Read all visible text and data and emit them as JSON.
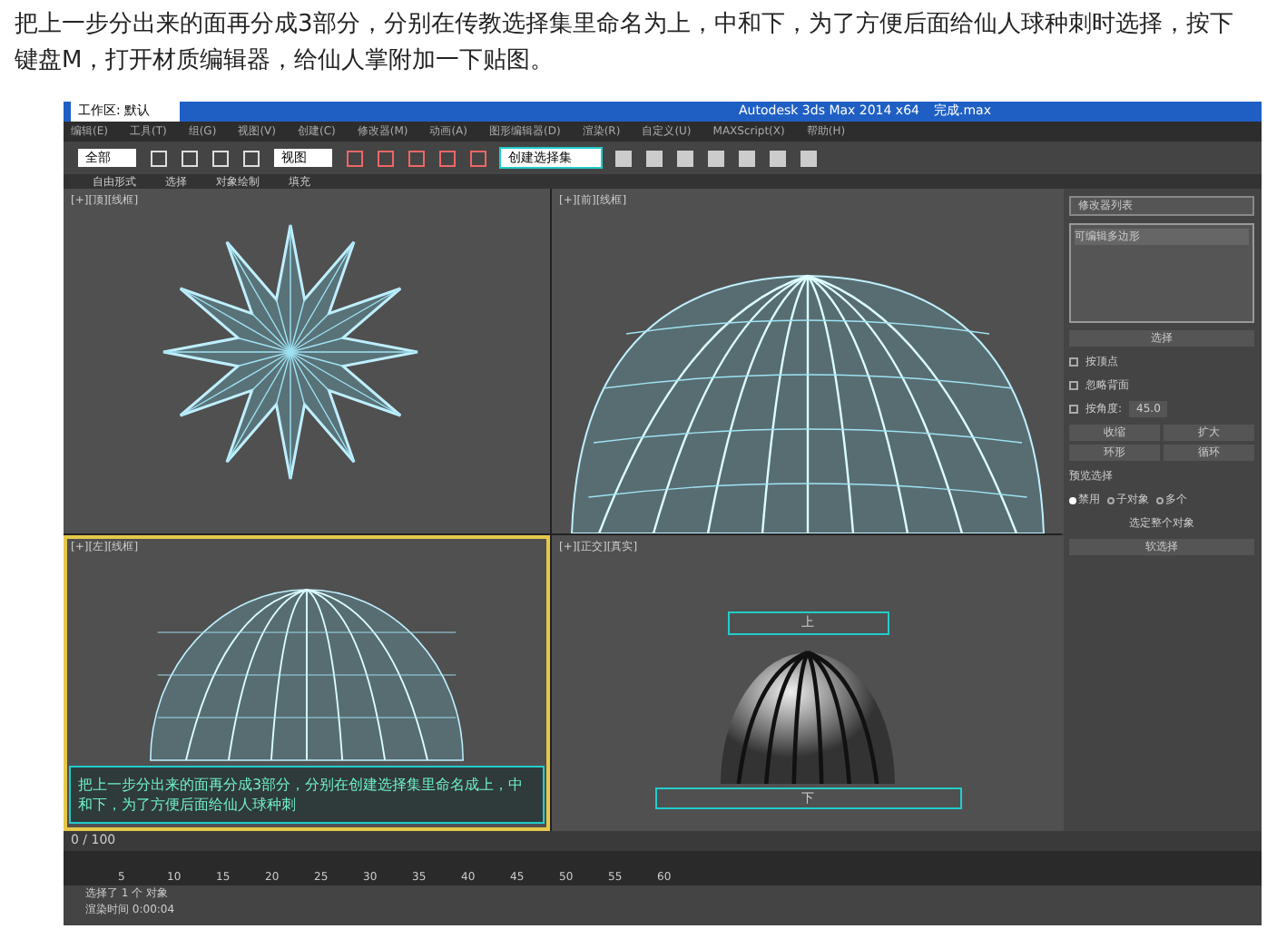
{
  "intro": {
    "text": "把上一步分出来的面再分成3部分，分别在传教选择集里命名为上，中和下，为了方便后面给仙人球种刺时选择，按下键盘M，打开材质编辑器，给仙人掌附加一下贴图。"
  },
  "app": {
    "workspace": "工作区: 默认",
    "title": "Autodesk 3ds Max  2014 x64",
    "file": "完成.max",
    "menus": [
      "编辑(E)",
      "工具(T)",
      "组(G)",
      "视图(V)",
      "创建(C)",
      "修改器(M)",
      "动画(A)",
      "图形编辑器(D)",
      "渲染(R)",
      "自定义(U)",
      "MAXScript(X)",
      "帮助(H)"
    ],
    "filter": "全部",
    "coord": "视图",
    "selection_set": "创建选择集",
    "ribbon_tabs": [
      "自由形式",
      "选择",
      "对象绘制",
      "填充"
    ],
    "viewports": [
      {
        "label": "[+][顶][线框]",
        "kind": "star",
        "selected": false
      },
      {
        "label": "[+][前][线框]",
        "kind": "dome",
        "selected": false
      },
      {
        "label": "[+][左][线框]",
        "kind": "sphere",
        "selected": true
      },
      {
        "label": "[+][正交][真实]",
        "kind": "shaded",
        "selected": false
      }
    ],
    "set_labels": [
      "上",
      "下"
    ],
    "caption": "把上一步分出来的面再分成3部分，分别在创建选择集里命名成上，中和下，为了方便后面给仙人球种刺",
    "command": {
      "modifier_list": "修改器列表",
      "stack_item": "可编辑多边形",
      "rollout": "选择",
      "checks": [
        {
          "label": "按顶点",
          "checked": false
        },
        {
          "label": "忽略背面",
          "checked": false
        },
        {
          "label": "按角度:",
          "checked": false
        }
      ],
      "angle": "45.0",
      "buttons": [
        "收缩",
        "扩大",
        "环形",
        "循环"
      ],
      "preview_title": "预览选择",
      "preview": [
        {
          "label": "禁用",
          "selected": true
        },
        {
          "label": "子对象",
          "selected": false
        },
        {
          "label": "多个",
          "selected": false
        }
      ],
      "whole": "选定整个对象",
      "soft": "软选择"
    }
  },
  "timeline": {
    "frame": "0 / 100",
    "ticks": [
      "5",
      "10",
      "15",
      "20",
      "25",
      "30",
      "35",
      "40",
      "45",
      "50",
      "55",
      "60"
    ]
  },
  "status": [
    "选择了 1 个 对象",
    "渲染时间 0:00:04"
  ]
}
